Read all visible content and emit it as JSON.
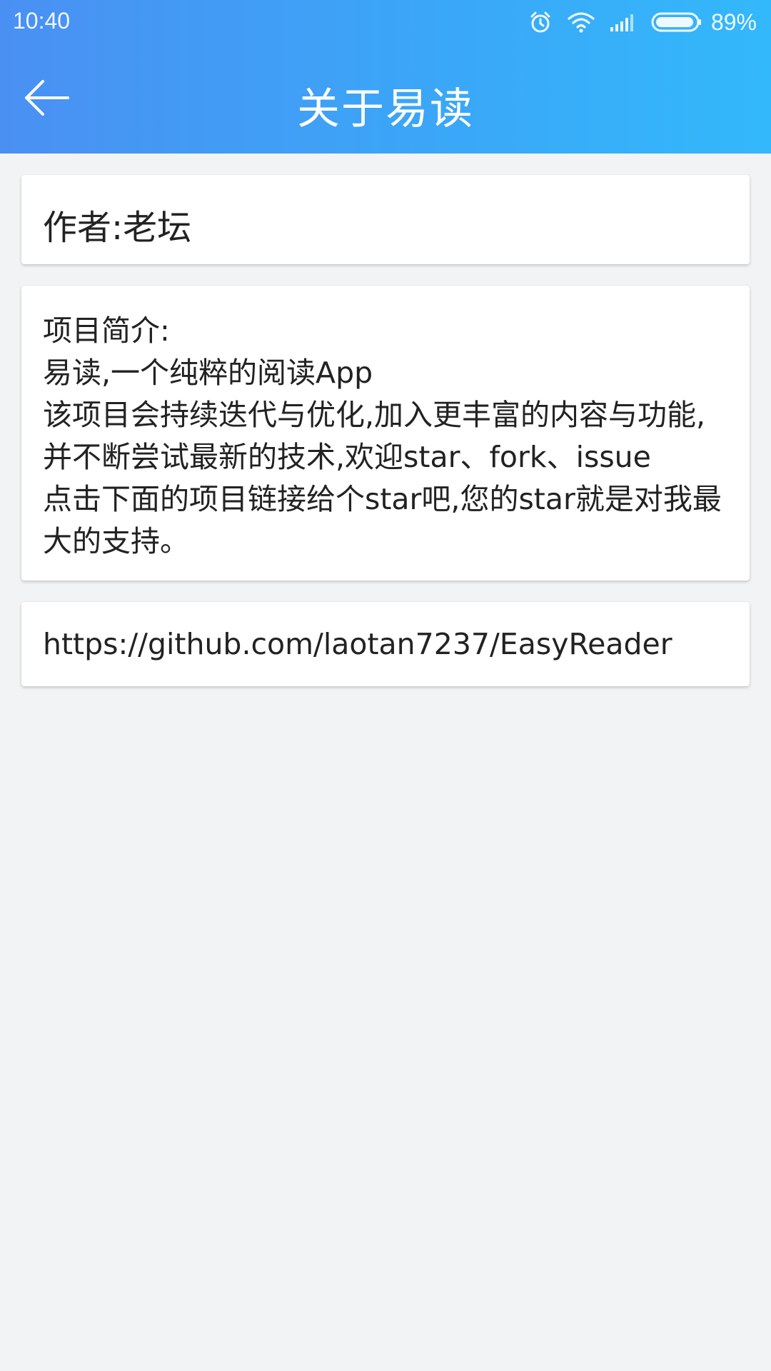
{
  "status_bar": {
    "time": "10:40",
    "battery_percent": "89%",
    "icons": [
      "alarm-icon",
      "wifi-icon",
      "signal-icon",
      "battery-icon"
    ]
  },
  "toolbar": {
    "back_icon": "arrow-left-icon",
    "title": "关于易读"
  },
  "author": {
    "text": "作者:老坛"
  },
  "intro": {
    "lines": [
      "项目简介:",
      "易读,一个纯粹的阅读App",
      "该项目会持续迭代与优化,加入更丰富的内容与功能,",
      "并不断尝试最新的技术,欢迎star、fork、issue",
      "点击下面的项目链接给个star吧,您的star就是对我最",
      "大的支持。"
    ]
  },
  "link": {
    "url": "https://github.com/laotan7237/EasyReader"
  },
  "colors": {
    "header_gradient_start": "#4a90f3",
    "header_gradient_end": "#33b8fb",
    "background": "#f2f3f5",
    "card": "#ffffff",
    "text": "#222222"
  }
}
